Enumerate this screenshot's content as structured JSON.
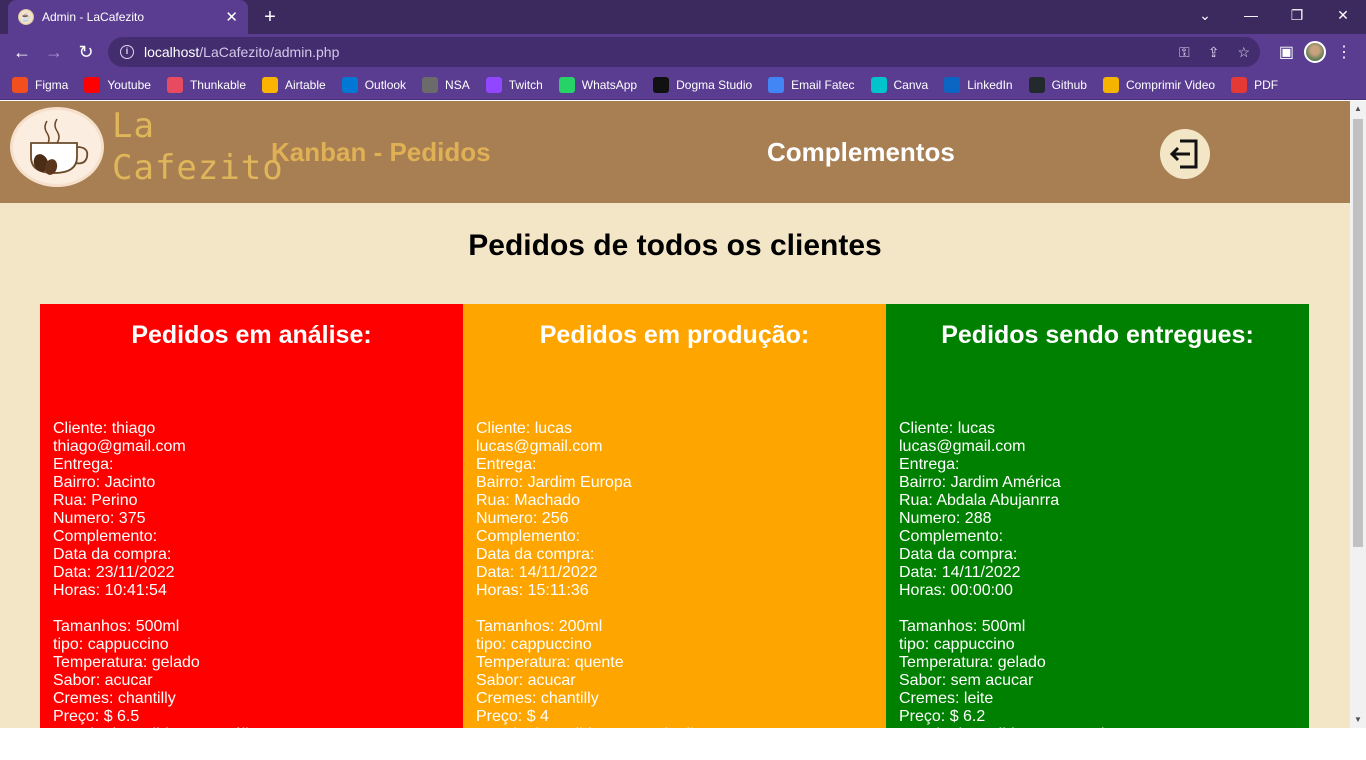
{
  "browser": {
    "tab_title": "Admin - LaCafezito",
    "url_host": "localhost",
    "url_path": "/LaCafezito/admin.php",
    "bookmarks": [
      {
        "label": "Figma",
        "icon": "figma-icon",
        "color": "#f24e1e"
      },
      {
        "label": "Youtube",
        "icon": "youtube-icon",
        "color": "#ff0000"
      },
      {
        "label": "Thunkable",
        "icon": "thunkable-icon",
        "color": "#e84a5f"
      },
      {
        "label": "Airtable",
        "icon": "airtable-icon",
        "color": "#fcb400"
      },
      {
        "label": "Outlook",
        "icon": "outlook-icon",
        "color": "#0078d4"
      },
      {
        "label": "NSA",
        "icon": "nsa-icon",
        "color": "#6b6b6b"
      },
      {
        "label": "Twitch",
        "icon": "twitch-icon",
        "color": "#9146ff"
      },
      {
        "label": "WhatsApp",
        "icon": "whatsapp-icon",
        "color": "#25d366"
      },
      {
        "label": "Dogma Studio",
        "icon": "dogma-icon",
        "color": "#111111"
      },
      {
        "label": "Email Fatec",
        "icon": "email-fatec-icon",
        "color": "#4285f4"
      },
      {
        "label": "Canva",
        "icon": "canva-icon",
        "color": "#00c4cc"
      },
      {
        "label": "LinkedIn",
        "icon": "linkedin-icon",
        "color": "#0a66c2"
      },
      {
        "label": "Github",
        "icon": "github-icon",
        "color": "#24292e"
      },
      {
        "label": "Comprimir Video",
        "icon": "compress-video-icon",
        "color": "#f4b400"
      },
      {
        "label": "PDF",
        "icon": "pdf-icon",
        "color": "#e53935"
      }
    ]
  },
  "site": {
    "logo_text_1": "La",
    "logo_text_2": "Cafezito",
    "nav_kanban": "Kanban - Pedidos",
    "nav_complementos": "Complementos"
  },
  "page_title": "Pedidos de todos os clientes",
  "columns": [
    {
      "title": "Pedidos em análise:",
      "color": "#ff0000",
      "order": {
        "cliente": "Cliente: thiago",
        "email": "thiago@gmail.com",
        "entrega": "Entrega:",
        "bairro": "Bairro: Jacinto",
        "rua": "Rua: Perino",
        "numero": "Numero: 375",
        "complemento": "Complemento:",
        "data_compra": "Data da compra:",
        "data": "Data: 23/11/2022",
        "horas": "Horas: 10:41:54",
        "tamanhos": "Tamanhos: 500ml",
        "tipo": "tipo: cappuccino",
        "temperatura": "Temperatura: gelado",
        "sabor": "Sabor: acucar",
        "cremes": "Cremes: chantilly",
        "preco": "Preço: $ 6.5",
        "estado": "Estado do pedido: Em análise"
      }
    },
    {
      "title": "Pedidos em produção:",
      "color": "#ffa500",
      "order": {
        "cliente": "Cliente: lucas",
        "email": "lucas@gmail.com",
        "entrega": "Entrega:",
        "bairro": "Bairro: Jardim Europa",
        "rua": "Rua: Machado",
        "numero": "Numero: 256",
        "complemento": "Complemento:",
        "data_compra": "Data da compra:",
        "data": "Data: 14/11/2022",
        "horas": "Horas: 15:11:36",
        "tamanhos": "Tamanhos: 200ml",
        "tipo": "tipo: cappuccino",
        "temperatura": "Temperatura: quente",
        "sabor": "Sabor: acucar",
        "cremes": "Cremes: chantilly",
        "preco": "Preço: $ 4",
        "estado": "Estado do pedido: em produção"
      }
    },
    {
      "title": "Pedidos sendo entregues:",
      "color": "#008000",
      "order": {
        "cliente": "Cliente: lucas",
        "email": "lucas@gmail.com",
        "entrega": "Entrega:",
        "bairro": "Bairro: Jardim América",
        "rua": "Rua: Abdala Abujanrra",
        "numero": "Numero: 288",
        "complemento": "Complemento:",
        "data_compra": "Data da compra:",
        "data": "Data: 14/11/2022",
        "horas": "Horas: 00:00:00",
        "tamanhos": "Tamanhos: 500ml",
        "tipo": "tipo: cappuccino",
        "temperatura": "Temperatura: gelado",
        "sabor": "Sabor: sem acucar",
        "cremes": "Cremes: leite",
        "preco": "Preço: $ 6.2",
        "estado": "Estado do pedido: entregando"
      }
    }
  ]
}
